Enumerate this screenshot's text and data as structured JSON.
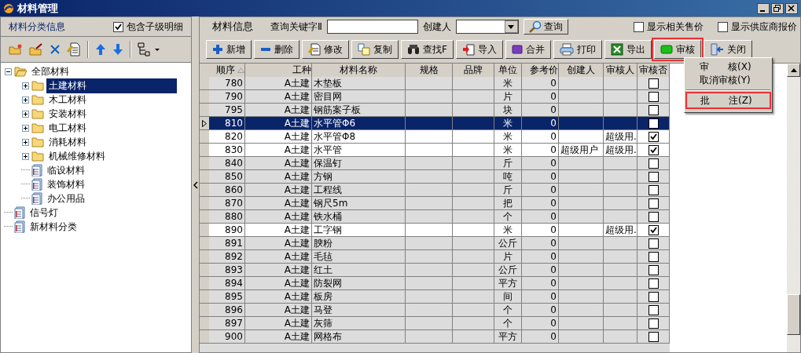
{
  "window": {
    "title": "材料管理"
  },
  "left_panel": {
    "title": "材料分类信息",
    "include_children": {
      "label": "包含子级明细",
      "checked": true
    },
    "tree": [
      {
        "label": "全部材料",
        "kind": "folder",
        "expanded": true,
        "selected": false,
        "children": [
          {
            "label": "土建材料",
            "kind": "folder",
            "expanded": false,
            "selected": true
          },
          {
            "label": "木工材料",
            "kind": "folder",
            "expanded": false,
            "selected": false
          },
          {
            "label": "安装材料",
            "kind": "folder",
            "expanded": false,
            "selected": false
          },
          {
            "label": "电工材料",
            "kind": "folder",
            "expanded": false,
            "selected": false
          },
          {
            "label": "消耗材料",
            "kind": "folder",
            "expanded": false,
            "selected": false
          },
          {
            "label": "机械维修材料",
            "kind": "folder",
            "expanded": false,
            "selected": false
          },
          {
            "label": "临设材料",
            "kind": "doc",
            "selected": false
          },
          {
            "label": "装饰材料",
            "kind": "doc",
            "selected": false
          },
          {
            "label": "办公用品",
            "kind": "doc",
            "selected": false
          }
        ]
      },
      {
        "label": "信号灯",
        "kind": "doc",
        "selected": false
      },
      {
        "label": "新材料分类",
        "kind": "doc",
        "selected": false
      }
    ]
  },
  "search_bar": {
    "title": "材料信息",
    "keyword_label": "查询关键字Ⅱ",
    "creator_label": "创建人",
    "search_button": "查询",
    "options": [
      {
        "label": "显示相关售价",
        "checked": false
      },
      {
        "label": "显示供应商报价",
        "checked": false
      }
    ]
  },
  "toolbar": [
    {
      "label": "新增",
      "marked": false
    },
    {
      "label": "删除",
      "marked": false
    },
    {
      "label": "修改",
      "marked": false
    },
    {
      "label": "复制",
      "marked": false
    },
    {
      "label": "查找F",
      "marked": false
    },
    {
      "label": "导入",
      "marked": false
    },
    {
      "label": "合并",
      "marked": false
    },
    {
      "label": "打印",
      "marked": false
    },
    {
      "label": "导出",
      "marked": false
    },
    {
      "label": "审核",
      "marked": true
    },
    {
      "label": "关闭",
      "marked": false
    }
  ],
  "audit_menu": [
    {
      "label": "审　　核(X)",
      "marked": false
    },
    {
      "label": "取消审核(Y)",
      "marked": false
    },
    {
      "label": "批　　注(Z)",
      "marked": true,
      "separator_before": true
    }
  ],
  "table": {
    "columns": [
      "顺序",
      "工种",
      "材料名称",
      "规格",
      "品牌",
      "单位",
      "参考价",
      "创建人",
      "审核人",
      "审核否"
    ],
    "rows": [
      {
        "order": "780",
        "trade": "A土建",
        "name": "木垫板",
        "unit": "米",
        "price": "0",
        "audited": false,
        "selected": false
      },
      {
        "order": "790",
        "trade": "A土建",
        "name": "密目网",
        "unit": "片",
        "price": "0",
        "audited": false,
        "selected": false
      },
      {
        "order": "795",
        "trade": "A土建",
        "name": "钢筋案子板",
        "unit": "块",
        "price": "0",
        "audited": false,
        "selected": false
      },
      {
        "order": "810",
        "trade": "A土建",
        "name": "水平管Φ6",
        "unit": "米",
        "price": "0",
        "audited": false,
        "selected": true
      },
      {
        "order": "820",
        "trade": "A土建",
        "name": "水平管Φ8",
        "unit": "米",
        "price": "0",
        "auditor": "超级用.",
        "audited": true,
        "selected": false
      },
      {
        "order": "830",
        "trade": "A土建",
        "name": "水平管",
        "unit": "米",
        "price": "0",
        "creator": "超级用户",
        "auditor": "超级用.",
        "audited": true,
        "selected": false
      },
      {
        "order": "840",
        "trade": "A土建",
        "name": "保温钉",
        "unit": "斤",
        "price": "0",
        "audited": false,
        "selected": false
      },
      {
        "order": "850",
        "trade": "A土建",
        "name": "方钢",
        "unit": "吨",
        "price": "0",
        "audited": false,
        "selected": false
      },
      {
        "order": "860",
        "trade": "A土建",
        "name": "工程线",
        "unit": "斤",
        "price": "0",
        "audited": false,
        "selected": false
      },
      {
        "order": "870",
        "trade": "A土建",
        "name": "钢尺5m",
        "unit": "把",
        "price": "0",
        "audited": false,
        "selected": false
      },
      {
        "order": "880",
        "trade": "A土建",
        "name": "铁水桶",
        "unit": "个",
        "price": "0",
        "audited": false,
        "selected": false
      },
      {
        "order": "890",
        "trade": "A土建",
        "name": "工字钢",
        "unit": "米",
        "price": "0",
        "auditor": "超级用.",
        "audited": true,
        "selected": false
      },
      {
        "order": "891",
        "trade": "A土建",
        "name": "腴粉",
        "unit": "公斤",
        "price": "0",
        "audited": false,
        "selected": false
      },
      {
        "order": "892",
        "trade": "A土建",
        "name": "毛毡",
        "unit": "片",
        "price": "0",
        "audited": false,
        "selected": false
      },
      {
        "order": "893",
        "trade": "A土建",
        "name": "红土",
        "unit": "公斤",
        "price": "0",
        "audited": false,
        "selected": false
      },
      {
        "order": "894",
        "trade": "A土建",
        "name": "防裂网",
        "unit": "平方",
        "price": "0",
        "audited": false,
        "selected": false
      },
      {
        "order": "895",
        "trade": "A土建",
        "name": "板房",
        "unit": "间",
        "price": "0",
        "audited": false,
        "selected": false
      },
      {
        "order": "896",
        "trade": "A土建",
        "name": "马登",
        "unit": "个",
        "price": "0",
        "audited": false,
        "selected": false
      },
      {
        "order": "897",
        "trade": "A土建",
        "name": "灰筛",
        "unit": "个",
        "price": "0",
        "audited": false,
        "selected": false
      },
      {
        "order": "900",
        "trade": "A土建",
        "name": "网格布",
        "unit": "平方",
        "price": "0",
        "audited": false,
        "selected": false
      }
    ]
  }
}
